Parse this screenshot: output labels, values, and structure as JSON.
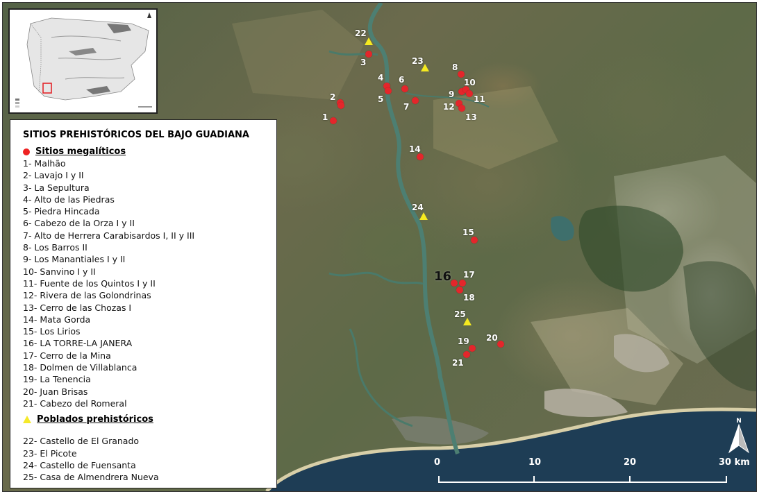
{
  "legend": {
    "title": "SITIOS PREHISTÓRICOS DEL BAJO GUADIANA",
    "megalithic_heading": "Sitios megalíticos",
    "megalithic_items": [
      "1- Malhão",
      "2- Lavajo I y II",
      "3- La Sepultura",
      "4- Alto de las Piedras",
      "5- Piedra Hincada",
      "6- Cabezo de la Orza I y II",
      "7- Alto de Herrera Carabisardos I, II y III",
      "8- Los Barros II",
      "9- Los Manantiales I y II",
      "10- Sanvino I y II",
      "11- Fuente de los Quintos I y II",
      "12- Rivera de las Golondrinas",
      "13- Cerro de las Chozas I",
      "14- Mata Gorda",
      "15- Los Lirios",
      "16- LA TORRE-LA JANERA",
      "17- Cerro de la Mina",
      "18- Dolmen de Villablanca",
      "19- La Tenencia",
      "20- Juan Brisas",
      "21- Cabezo del Romeral"
    ],
    "settlement_heading": "Poblados prehistóricos",
    "settlement_items": [
      "22- Castello de El Granado",
      "23- El Picote",
      "24- Castello de Fuensanta",
      "25- Casa de Almendrera Nueva"
    ]
  },
  "markers": {
    "site_labels": [
      "1",
      "2",
      "3",
      "4",
      "5",
      "6",
      "7",
      "8",
      "9",
      "10",
      "11",
      "12",
      "13",
      "14",
      "15",
      "16",
      "17",
      "18",
      "19",
      "20",
      "21"
    ],
    "settlement_labels": [
      "22",
      "23",
      "24",
      "25"
    ]
  },
  "scale_bar": {
    "ticks": [
      "0",
      "10",
      "20",
      "30 km"
    ]
  },
  "north_arrow": {
    "label": "N"
  },
  "colors": {
    "megalithic_marker": "#e4262b",
    "settlement_marker": "#f5ea20",
    "inset_highlight": "#e4262b"
  }
}
